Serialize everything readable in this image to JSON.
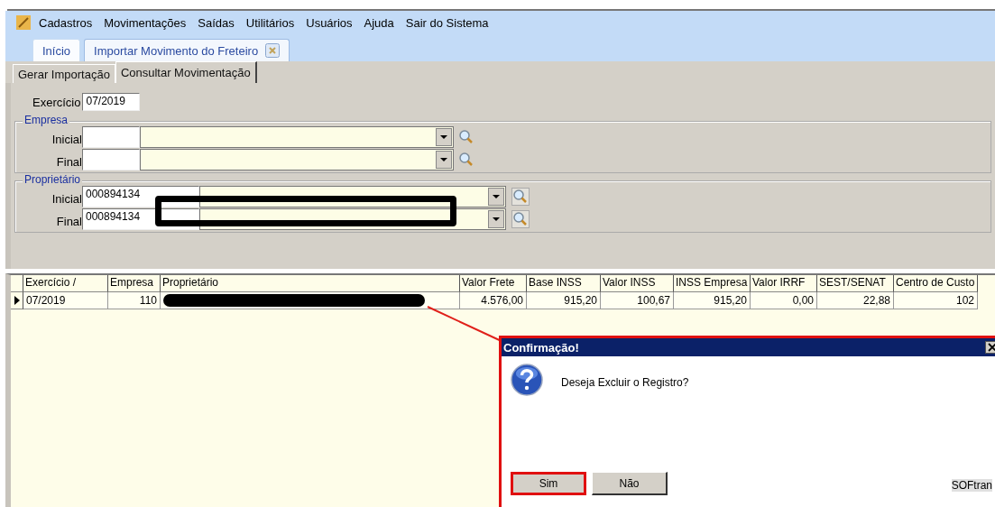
{
  "menu": [
    "Cadastros",
    "Movimentações",
    "Saídas",
    "Utilitários",
    "Usuários",
    "Ajuda",
    "Sair do Sistema"
  ],
  "tabs": [
    {
      "label": "Início",
      "selected": false,
      "closable": false
    },
    {
      "label": "Importar Movimento do Freteiro",
      "selected": true,
      "closable": true
    }
  ],
  "subtabs": [
    {
      "label": "Gerar Importação",
      "selected": false
    },
    {
      "label": "Consultar Movimentação",
      "selected": true
    }
  ],
  "exercicio": {
    "label": "Exercício",
    "value": "07/2019"
  },
  "groups": [
    {
      "title": "Empresa",
      "redacted": false,
      "rows": [
        {
          "label": "Inicial",
          "code": ""
        },
        {
          "label": "Final",
          "code": ""
        }
      ]
    },
    {
      "title": "Proprietário",
      "redacted": true,
      "rows": [
        {
          "label": "Inicial",
          "code": "000894134"
        },
        {
          "label": "Final",
          "code": "000894134"
        }
      ]
    }
  ],
  "table": {
    "columns": [
      "Exercício /",
      "Empresa",
      "Proprietário",
      "Valor Frete",
      "Base INSS",
      "Valor INSS",
      "INSS Empresa",
      "Valor IRRF",
      "SEST/SENAT",
      "Centro de Custo"
    ],
    "rows": [
      {
        "selected": true,
        "cells": [
          "07/2019",
          "110",
          "",
          "4.576,00",
          "915,20",
          "100,67",
          "915,20",
          "0,00",
          "22,88",
          "102"
        ]
      }
    ]
  },
  "dialog": {
    "title": "Confirmação!",
    "message": "Deseja Excluir o Registro?",
    "buttons": [
      {
        "label": "Sim",
        "highlighted": true
      },
      {
        "label": "Não",
        "highlighted": false
      }
    ],
    "brand": "SOFtran"
  }
}
